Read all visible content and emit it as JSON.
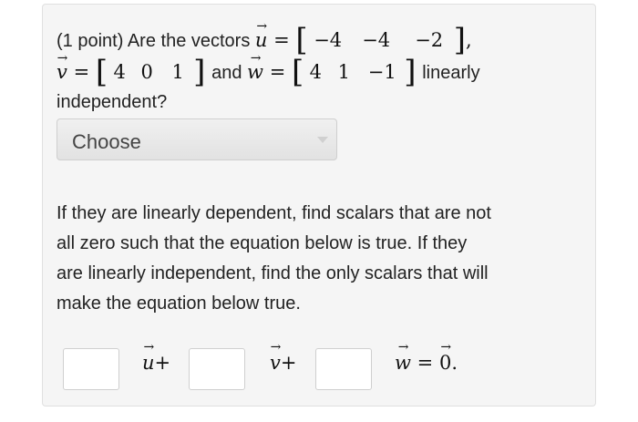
{
  "question": {
    "points": "(1 point)",
    "intro": "Are the vectors",
    "u_name": "u",
    "u_entries": [
      "−4",
      "−4",
      "−2"
    ],
    "v_name": "v",
    "v_entries": [
      "4",
      "0",
      "1"
    ],
    "w_name": "w",
    "w_entries": [
      "4",
      "1",
      "−1"
    ],
    "and": "and",
    "linearly": "linearly",
    "independent": "independent?",
    "equals": "=",
    "comma": ","
  },
  "dropdown": {
    "selected": "Choose"
  },
  "instructions": [
    "If they are linearly dependent, find scalars that are not",
    "all zero such that the equation below is true. If they",
    "are linearly independent, find the only scalars that will",
    "make the equation below true."
  ],
  "equation": {
    "u": "u",
    "v": "v",
    "w": "w",
    "plus": "+",
    "equals": "=",
    "zero": "0",
    "period": ".",
    "arrow": "→",
    "inputs": [
      "",
      "",
      ""
    ]
  }
}
